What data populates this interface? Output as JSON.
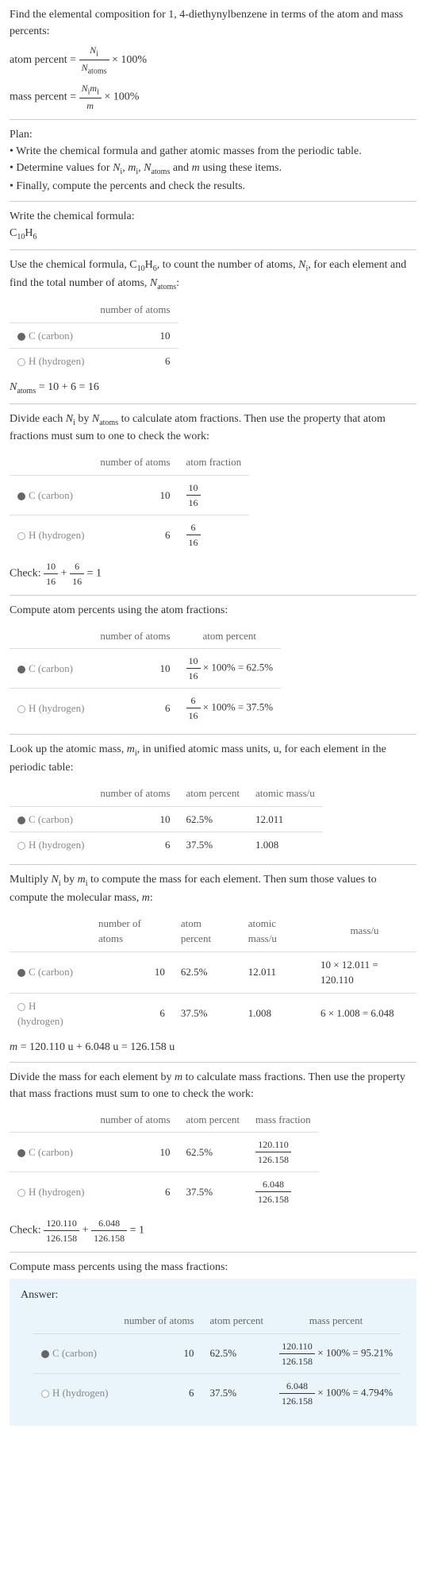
{
  "intro": {
    "line1": "Find the elemental composition for 1, 4-diethynylbenzene in terms of the atom and mass percents:",
    "atom_percent_label": "atom percent = ",
    "atom_percent_tail": " × 100%",
    "mass_percent_label": "mass percent = ",
    "mass_percent_tail": " × 100%",
    "ni": "N",
    "ni_sub": "i",
    "natoms": "N",
    "natoms_sub": "atoms",
    "nimi_top_a": "N",
    "nimi_top_b": "m",
    "m": "m"
  },
  "plan": {
    "title": "Plan:",
    "b1": "• Write the chemical formula and gather atomic masses from the periodic table.",
    "b2_a": "• Determine values for ",
    "b2_b": " and ",
    "b2_c": " using these items.",
    "b3": "• Finally, compute the percents and check the results."
  },
  "step1": {
    "title": "Write the chemical formula:",
    "formula_c": "C",
    "formula_c_sub": "10",
    "formula_h": "H",
    "formula_h_sub": "6"
  },
  "step2": {
    "text_a": "Use the chemical formula, C",
    "text_b": "H",
    "text_c": ", to count the number of atoms, ",
    "text_d": ", for each element and find the total number of atoms, ",
    "text_e": ":",
    "hdr_atoms": "number of atoms",
    "c_label": "C (carbon)",
    "c_n": "10",
    "h_label": "H (hydrogen)",
    "h_n": "6",
    "total": " = 10 + 6 = 16"
  },
  "step3": {
    "text_a": "Divide each ",
    "text_b": " by ",
    "text_c": " to calculate atom fractions. Then use the property that atom fractions must sum to one to check the work:",
    "hdr_frac": "atom fraction",
    "c_num": "10",
    "c_den": "16",
    "h_num": "6",
    "h_den": "16",
    "check_a": "Check: ",
    "check_b": " + ",
    "check_c": " = 1"
  },
  "step4": {
    "title": "Compute atom percents using the atom fractions:",
    "hdr_ap": "atom percent",
    "c_calc": " × 100% = 62.5%",
    "h_calc": " × 100% = 37.5%"
  },
  "step5": {
    "text_a": "Look up the atomic mass, ",
    "text_b": ", in unified atomic mass units, u, for each element in the periodic table:",
    "hdr_mass": "atomic mass/u",
    "c_ap": "62.5%",
    "c_mass": "12.011",
    "h_ap": "37.5%",
    "h_mass": "1.008"
  },
  "step6": {
    "text_a": "Multiply ",
    "text_b": " by ",
    "text_c": " to compute the mass for each element. Then sum those values to compute the molecular mass, ",
    "text_d": ":",
    "hdr_massu": "mass/u",
    "c_calc": "10 × 12.011 = 120.110",
    "h_calc": "6 × 1.008 = 6.048",
    "total": " = 120.110 u + 6.048 u = 126.158 u"
  },
  "step7": {
    "text": "Divide the mass for each element by m to calculate mass fractions. Then use the property that mass fractions must sum to one to check the work:",
    "hdr_mf": "mass fraction",
    "c_num": "120.110",
    "c_den": "126.158",
    "h_num": "6.048",
    "h_den": "126.158",
    "check_a": "Check: ",
    "check_b": " + ",
    "check_c": " = 1"
  },
  "step8": {
    "title": "Compute mass percents using the mass fractions:"
  },
  "answer": {
    "label": "Answer:",
    "hdr_mp": "mass percent",
    "c_calc": " × 100% = 95.21%",
    "h_calc": " × 100% = 4.794%"
  }
}
